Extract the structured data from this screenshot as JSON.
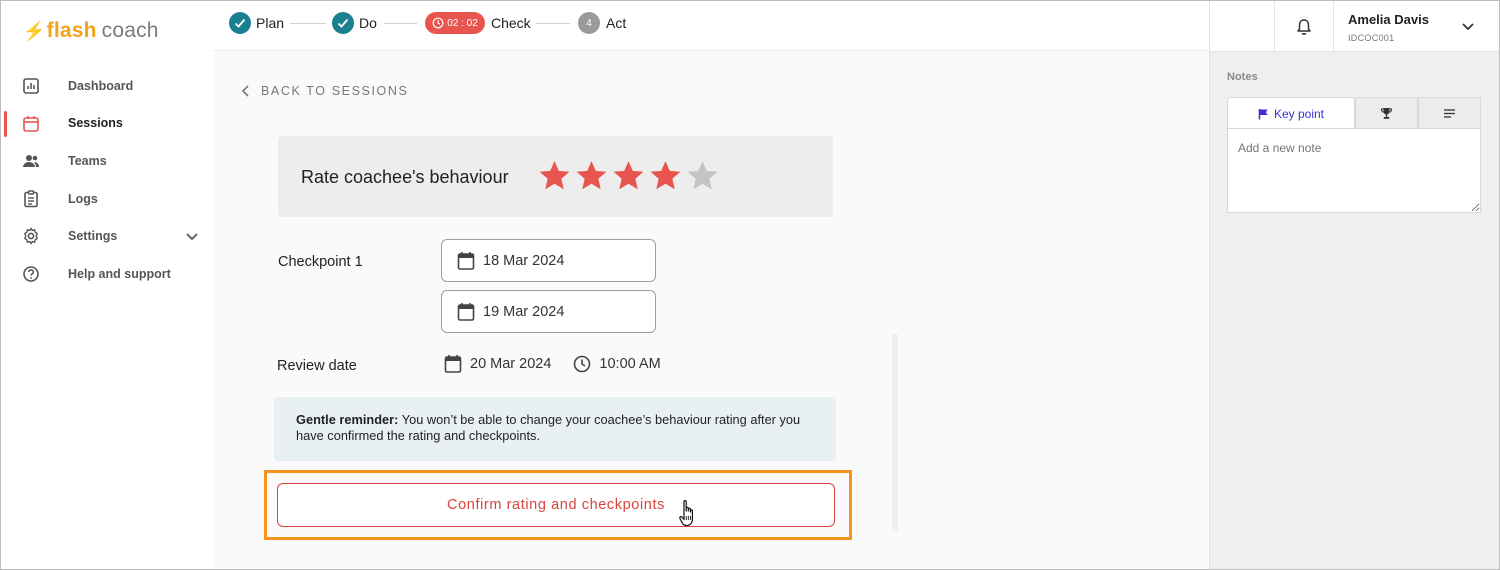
{
  "app": {
    "logo_flash": "flash",
    "logo_coach": "coach",
    "brand_color": "#f4a316"
  },
  "sidebar": {
    "items": [
      {
        "label": "Dashboard",
        "icon": "dashboard-icon"
      },
      {
        "label": "Sessions",
        "icon": "calendar-icon",
        "active": true
      },
      {
        "label": "Teams",
        "icon": "people-icon"
      },
      {
        "label": "Logs",
        "icon": "clipboard-icon"
      },
      {
        "label": "Settings",
        "icon": "gear-icon",
        "expandable": true
      },
      {
        "label": "Help and support",
        "icon": "help-icon"
      }
    ]
  },
  "stepper": {
    "steps": [
      {
        "label": "Plan",
        "state": "done"
      },
      {
        "label": "Do",
        "state": "done"
      },
      {
        "label": "Check",
        "state": "current",
        "timer": "02 : 02"
      },
      {
        "label": "Act",
        "state": "pending",
        "number": "4"
      }
    ]
  },
  "main": {
    "back_label": "BACK TO SESSIONS",
    "rating": {
      "title": "Rate coachee's behaviour",
      "value": 4,
      "max": 5,
      "filled_color": "#e8554e",
      "empty_color": "#c4c4c4"
    },
    "checkpoint": {
      "label": "Checkpoint 1",
      "dates": [
        "18 Mar 2024",
        "19 Mar 2024"
      ]
    },
    "review": {
      "label": "Review date",
      "date": "20 Mar 2024",
      "time": "10:00 AM"
    },
    "reminder": {
      "bold": "Gentle reminder:",
      "text": " You won’t be able to change your coachee’s behaviour rating after you have confirmed the rating and checkpoints."
    },
    "confirm_label": "Confirm rating and checkpoints",
    "accent_color": "#d9433d",
    "highlight_color": "#f4931f"
  },
  "user": {
    "name": "Amelia Davis",
    "id": "IDCOC001"
  },
  "notes": {
    "label": "Notes",
    "tabs": [
      {
        "label": "Key point",
        "icon": "flag-icon",
        "active": true
      },
      {
        "label": "",
        "icon": "trophy-icon"
      },
      {
        "label": "",
        "icon": "lines-icon"
      }
    ],
    "placeholder": "Add a new note"
  }
}
